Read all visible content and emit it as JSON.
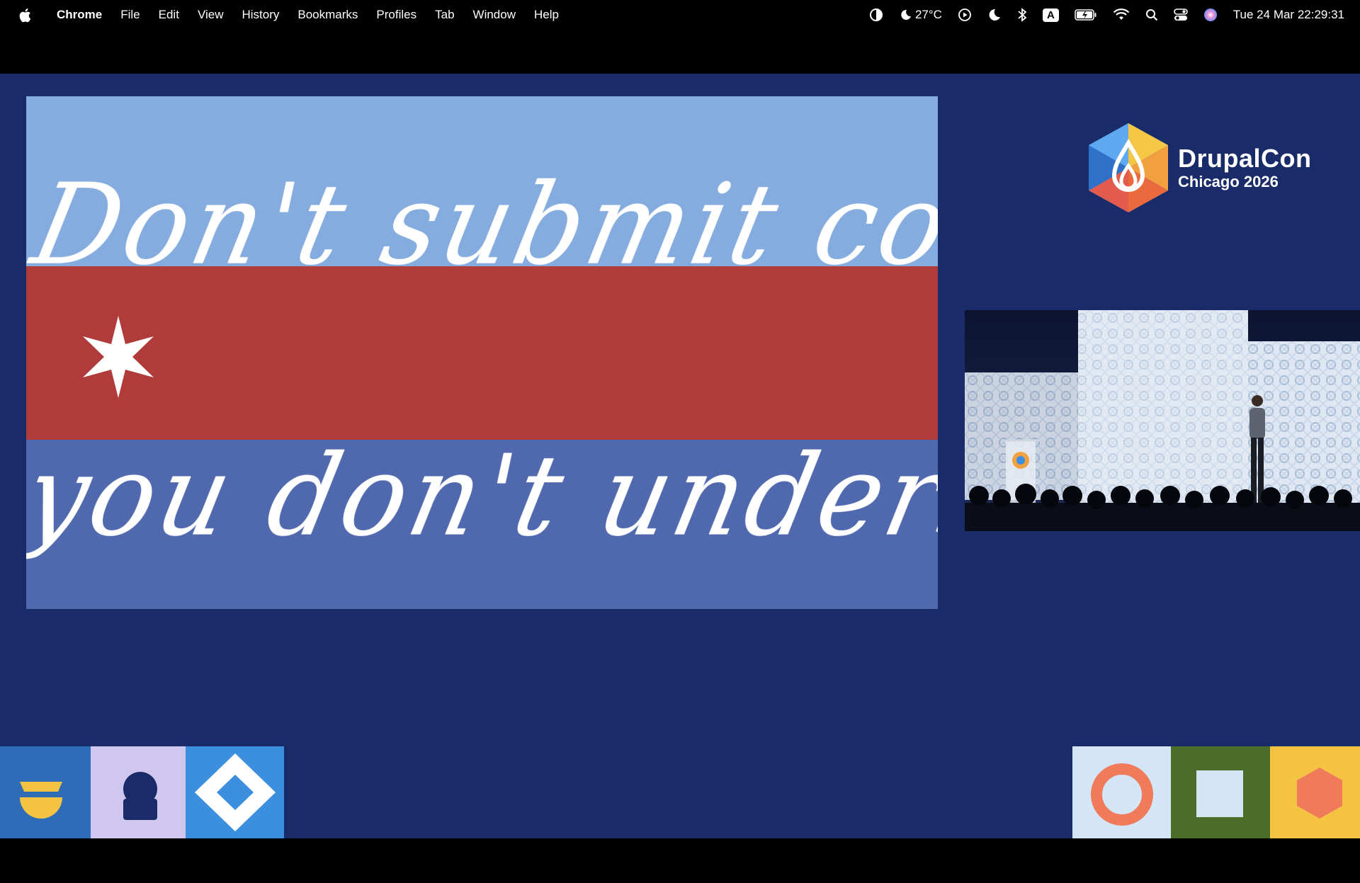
{
  "menubar": {
    "app_name": "Chrome",
    "menus": [
      "File",
      "Edit",
      "View",
      "History",
      "Bookmarks",
      "Profiles",
      "Tab",
      "Window",
      "Help"
    ],
    "weather": "27°C",
    "keyboard_indicator": "A",
    "clock": "Tue 24 Mar  22:29:31",
    "icons": [
      "apple-icon",
      "focus-icon",
      "weather-icon",
      "now-playing-icon",
      "do-not-disturb-icon",
      "bluetooth-icon",
      "keyboard-input-icon",
      "battery-icon",
      "wifi-icon",
      "spotlight-icon",
      "control-center-icon",
      "siri-icon"
    ]
  },
  "slide": {
    "line1": "Don't submit code",
    "line2": "you don't understand.",
    "colors": {
      "top": "#85acdf",
      "middle": "#b03b3a",
      "bottom": "#5069ae",
      "star": "#ffffff"
    },
    "icons": [
      "six-point-star-icon"
    ]
  },
  "branding": {
    "name": "DrupalCon",
    "subtitle": "Chicago 2026",
    "icons": [
      "drupal-drop-hexagon-logo"
    ]
  },
  "video": {
    "description_icons": [
      "speaker-video-thumbnail"
    ]
  },
  "decor": {
    "left_tiles": [
      "yellow-bowl-shape-icon",
      "person-silhouette-icon",
      "diamond-icon"
    ],
    "right_tiles": [
      "ring-icon",
      "square-icon",
      "hexagon-icon"
    ],
    "colors": {
      "background": "#192b69",
      "accent_yellow": "#f5c342",
      "accent_orange": "#ef7b5b",
      "accent_green": "#4a6e2a"
    }
  }
}
